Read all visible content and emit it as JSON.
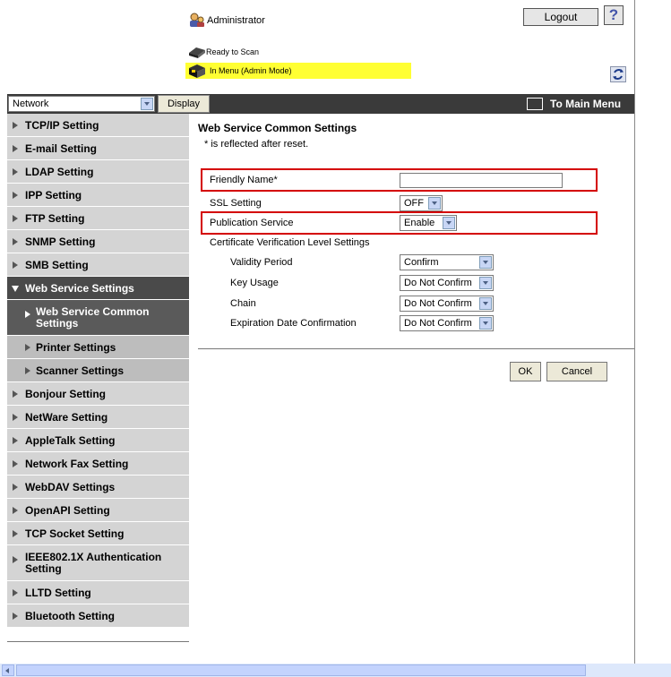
{
  "header": {
    "user_label": "Administrator",
    "logout_label": "Logout",
    "help_label": "?",
    "status_ready": "Ready to Scan",
    "status_menu": "In Menu (Admin Mode)"
  },
  "toolbar": {
    "category_selected": "Network",
    "display_label": "Display",
    "main_menu_label": "To Main Menu"
  },
  "sidebar": {
    "items": [
      {
        "label": "TCP/IP Setting"
      },
      {
        "label": "E-mail Setting"
      },
      {
        "label": "LDAP Setting"
      },
      {
        "label": "IPP Setting"
      },
      {
        "label": "FTP Setting"
      },
      {
        "label": "SNMP Setting"
      },
      {
        "label": "SMB Setting"
      },
      {
        "label": "Web Service Settings"
      },
      {
        "label": "Web Service Common Settings"
      },
      {
        "label": "Printer Settings"
      },
      {
        "label": "Scanner Settings"
      },
      {
        "label": "Bonjour Setting"
      },
      {
        "label": "NetWare Setting"
      },
      {
        "label": "AppleTalk Setting"
      },
      {
        "label": "Network Fax Setting"
      },
      {
        "label": "WebDAV Settings"
      },
      {
        "label": "OpenAPI Setting"
      },
      {
        "label": "TCP Socket Setting"
      },
      {
        "label": "IEEE802.1X Authentication Setting"
      },
      {
        "label": "LLTD Setting"
      },
      {
        "label": "Bluetooth Setting"
      }
    ]
  },
  "main": {
    "title": "Web Service Common Settings",
    "note": "* is reflected after reset.",
    "friendly_name_label": "Friendly Name*",
    "friendly_name_value": "",
    "ssl_label": "SSL Setting",
    "ssl_value": "OFF",
    "publication_label": "Publication Service",
    "publication_value": "Enable",
    "cert_section_label": "Certificate Verification Level Settings",
    "validity_label": "Validity Period",
    "validity_value": "Confirm",
    "key_usage_label": "Key Usage",
    "key_usage_value": "Do Not Confirm",
    "chain_label": "Chain",
    "chain_value": "Do Not Confirm",
    "expiration_label": "Expiration Date Confirmation",
    "expiration_value": "Do Not Confirm",
    "ok_label": "OK",
    "cancel_label": "Cancel"
  },
  "colors": {
    "highlight_box": "#d40000",
    "admin_bar": "#ffff33",
    "topbar": "#3a3a3a"
  }
}
